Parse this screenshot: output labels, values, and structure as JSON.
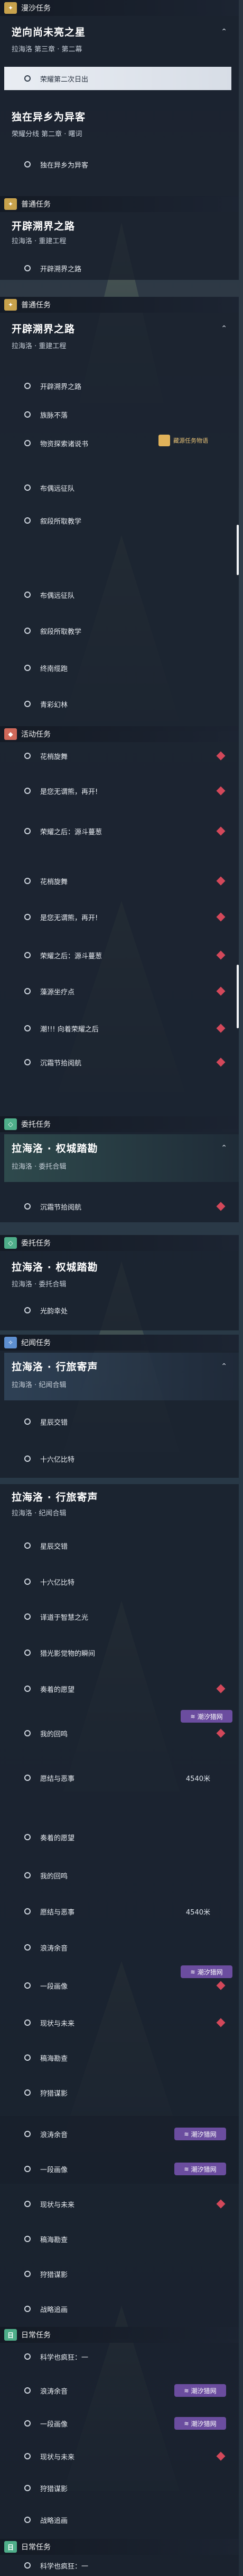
{
  "colors": {
    "gold": "#c8a24c",
    "green": "#4fae8a",
    "red": "#d0695a",
    "blue": "#5e8fd0",
    "tag": "#6b4d9f",
    "diamond": "#d3485a"
  },
  "sections": [
    {
      "category": "漫沙任务",
      "badge": "✦",
      "style": "gold",
      "title": "逆向尚未亮之星",
      "sub": "拉海洛 第三章 · 第二幕"
    },
    {
      "category": "普通任务",
      "badge": "✦",
      "style": "gold",
      "title": "开辟溯界之路",
      "sub": "拉海洛 · 重建工程"
    },
    {
      "category": "普通任务",
      "badge": "✦",
      "style": "gold",
      "title": "开辟溯界之路",
      "sub": "拉海洛 · 重建工程"
    },
    {
      "category": "活动任务",
      "badge": "◆",
      "style": "red"
    },
    {
      "category": "委托任务",
      "badge": "◇",
      "style": "green",
      "title": "拉海洛 · 权城踏勘",
      "sub": "拉海洛 · 委托合辑"
    },
    {
      "category": "委托任务",
      "badge": "◇",
      "style": "green",
      "title": "拉海洛 · 权城踏勘",
      "sub": "拉海洛 · 委托合辑"
    },
    {
      "category": "纪闻任务",
      "badge": "✧",
      "style": "blue",
      "title": "拉海洛 · 行旅寄声",
      "sub": "拉海洛 · 纪闻合辑"
    },
    {
      "category": "日常任务",
      "badge": "日",
      "style": "green"
    },
    {
      "category": "日常任务",
      "badge": "日",
      "style": "green"
    }
  ],
  "extra_heads": [
    {
      "title": "独在异乡为异客",
      "sub": "荣耀分线 第二章 · 曙词"
    },
    {
      "title": "拉海洛 · 行旅寄声",
      "sub": "拉海洛 · 纪闻合辑"
    }
  ],
  "items": {
    "s1": [
      "荣耀第二次日出"
    ],
    "s1b": [
      "独在异乡为异客"
    ],
    "s2": [
      "开辟溯界之路"
    ],
    "s3": [
      "开辟溯界之路",
      "族脉不落",
      "物资探索诸说书",
      "布偶远征队",
      "叙段所取教学",
      "布偶远征队",
      "叙段所取教学",
      "终南缆跑",
      "青彩幻林"
    ],
    "act": [
      "花梢旋舞",
      "是您无谓熊，再开!",
      "荣耀之后：源斗蔓葱",
      "花梢旋舞",
      "是您无谓熊，再开!",
      "荣耀之后：源斗蔓葱",
      "藻源坐疗点",
      "潮!!! 向着荣耀之后",
      "沉霜节拾阅航"
    ],
    "del1": [
      "沉霜节拾阅航"
    ],
    "del2": [
      "光韵幸处"
    ],
    "lore1": [
      "星辰交错",
      "十六亿比特"
    ],
    "lore2": [
      "星辰交错",
      "十六亿比特",
      "译道于智慧之光",
      "猎光影觉物的瞬间",
      "奏着的愿望",
      "我的回鸣",
      "愿结与恶事"
    ],
    "daily1": [
      "奏着的愿望",
      "我的回鸣",
      "愿结与恶事",
      "浪涛余音",
      "一段画像",
      "现状与未来",
      "稿海勘查",
      "狩猎谋影"
    ],
    "daily2": [
      "浪涛余音",
      "一段画像",
      "现状与未来",
      "稿海勘查",
      "狩猎谋影",
      "战略追画"
    ],
    "daily3": [
      "科学也疯狂：一",
      "浪涛余音",
      "一段画像",
      "现状与未来",
      "狩猎谋影",
      "战略追画",
      "科学也疯狂：一"
    ]
  },
  "distance": "4540米",
  "tag_label": "潮汐猎网",
  "stamp_label": "藏源任务物语",
  "icons": {
    "chevron": "chevron-up-icon",
    "radio": "radio-dot-icon",
    "diamond": "priority-diamond-icon"
  }
}
